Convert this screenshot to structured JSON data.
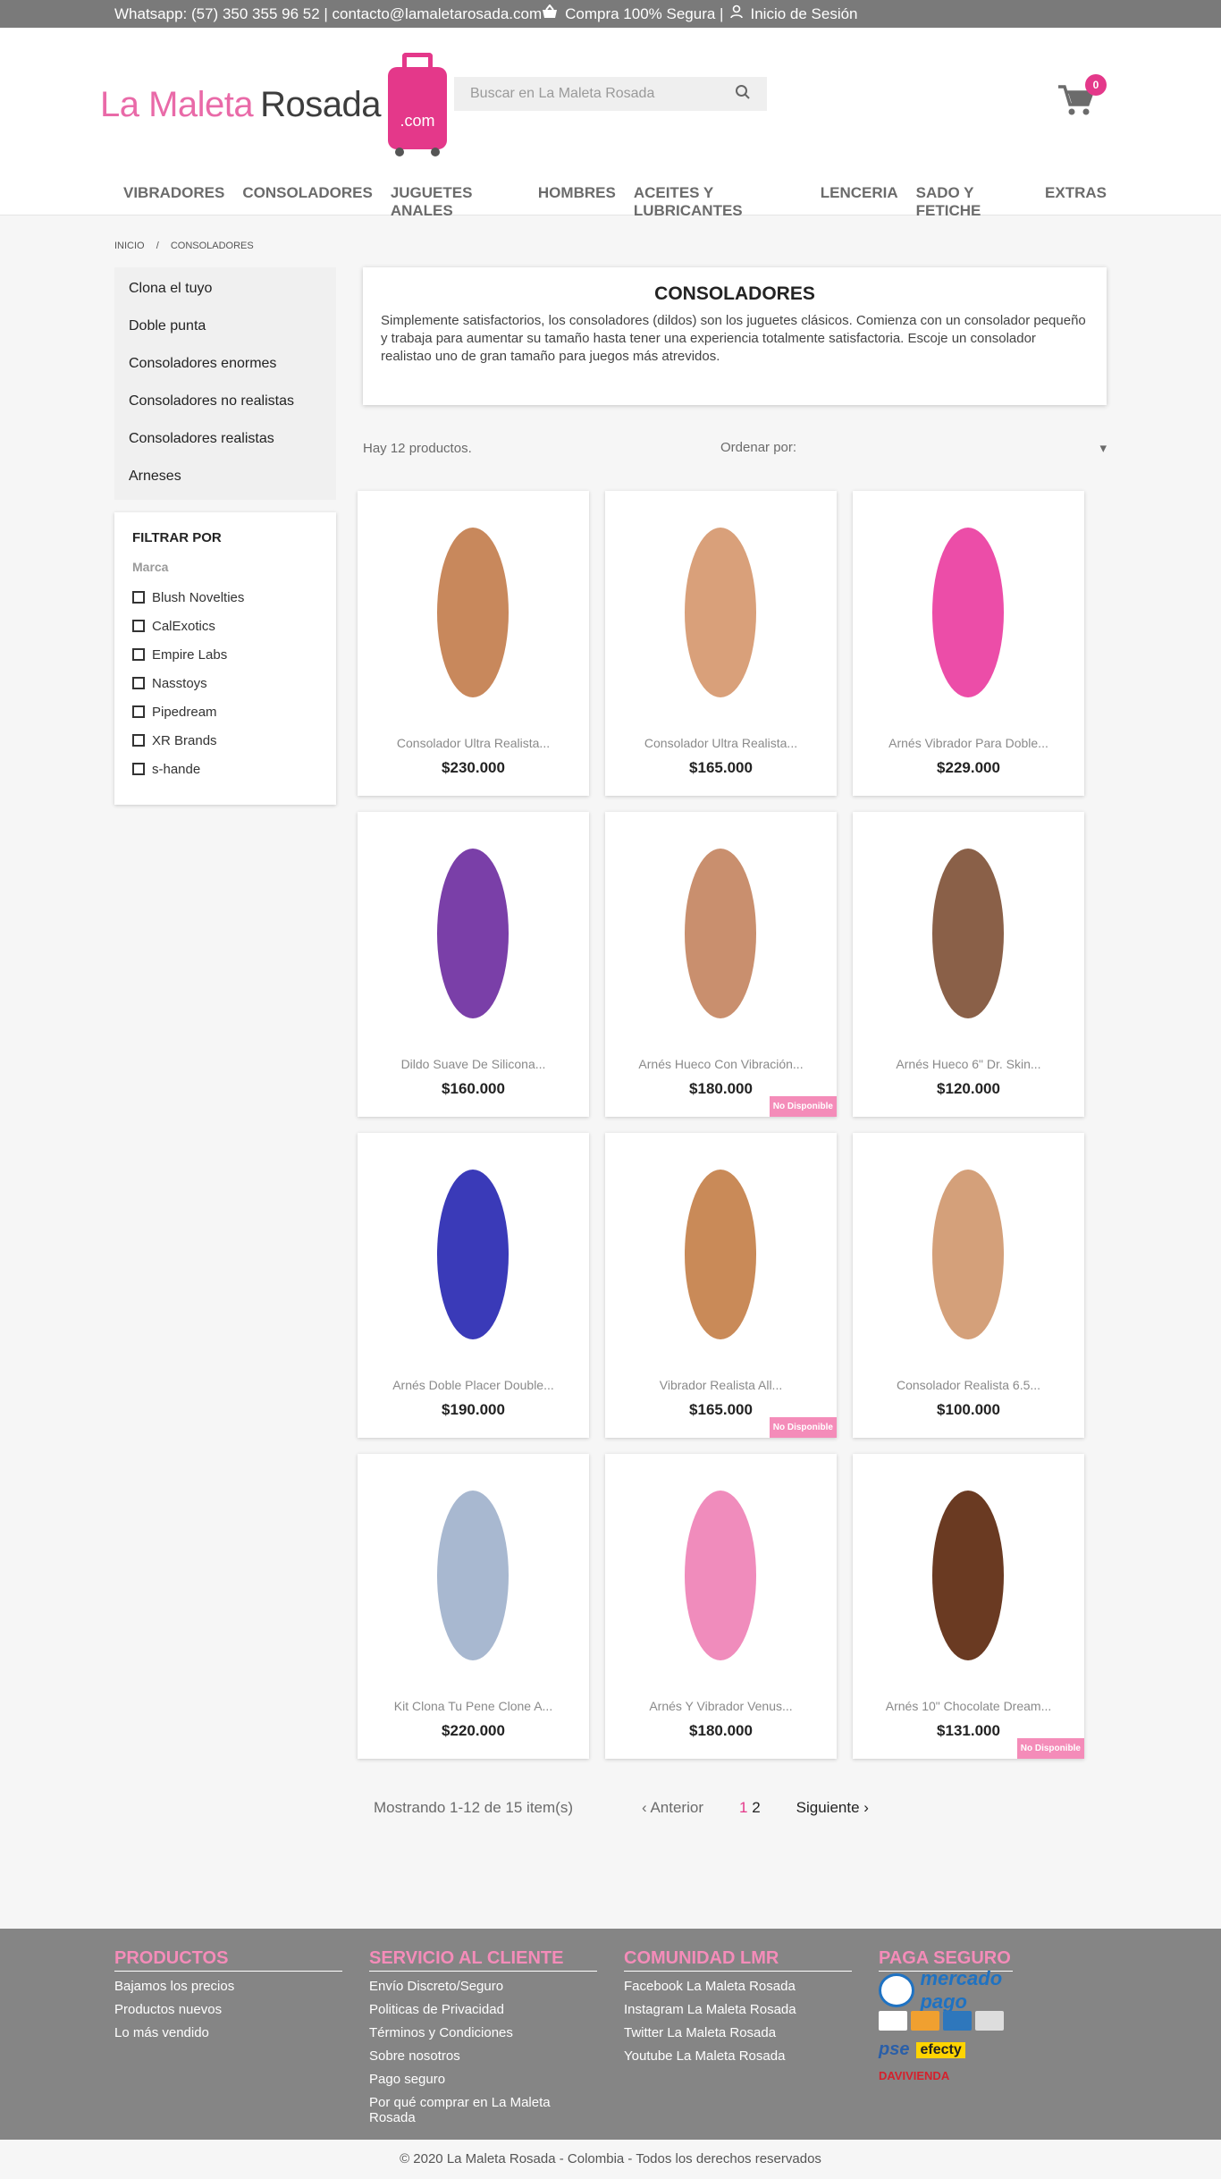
{
  "topbar": {
    "contact": "Whatsapp: (57) 350 355 96 52 | contacto@lamaletarosada.com",
    "secure": "Compra 100% Segura |",
    "login": "Inicio de Sesión"
  },
  "logo": {
    "word1": "La Maleta",
    "word2": "Rosada",
    "suffix": ".com"
  },
  "search": {
    "placeholder": "Buscar en La Maleta Rosada"
  },
  "cart": {
    "count": "0"
  },
  "nav": [
    "VIBRADORES",
    "CONSOLADORES",
    "JUGUETES ANALES",
    "HOMBRES",
    "ACEITES Y LUBRICANTES",
    "LENCERIA",
    "SADO Y FETICHE",
    "EXTRAS"
  ],
  "breadcrumb": {
    "home": "INICIO",
    "sep": "/",
    "current": "CONSOLADORES"
  },
  "categories": [
    "Clona el tuyo",
    "Doble punta",
    "Consoladores enormes",
    "Consoladores no realistas",
    "Consoladores realistas",
    "Arneses"
  ],
  "filter": {
    "title": "FILTRAR POR",
    "group": "Marca",
    "brands": [
      "Blush Novelties",
      "CalExotics",
      "Empire Labs",
      "Nasstoys",
      "Pipedream",
      "XR Brands",
      "s-hande"
    ]
  },
  "category": {
    "title": "CONSOLADORES",
    "description": "Simplemente satisfactorios, los consoladores (dildos) son los juguetes clásicos. Comienza con un consolador pequeño y trabaja para aumentar su tamaño hasta tener una experiencia totalmente satisfactoria. Escoje un consolador realistao uno de gran tamaño para juegos más atrevidos."
  },
  "listing": {
    "count": "Hay 12 productos.",
    "sort": "Ordenar por:"
  },
  "products": [
    {
      "name": "Consolador Ultra Realista...",
      "price": "$230.000",
      "badge": "",
      "color": "#c8885c"
    },
    {
      "name": "Consolador Ultra Realista...",
      "price": "$165.000",
      "badge": "",
      "color": "#d9a07a"
    },
    {
      "name": "Arnés Vibrador Para Doble...",
      "price": "$229.000",
      "badge": "",
      "color": "#ec4da8"
    },
    {
      "name": "Dildo Suave De Silicona...",
      "price": "$160.000",
      "badge": "",
      "color": "#7a3fa8"
    },
    {
      "name": "Arnés Hueco Con Vibración...",
      "price": "$180.000",
      "badge": "No Disponible",
      "color": "#c98f6e"
    },
    {
      "name": "Arnés Hueco 6\" Dr. Skin...",
      "price": "$120.000",
      "badge": "",
      "color": "#8a6048"
    },
    {
      "name": "Arnés Doble Placer Double...",
      "price": "$190.000",
      "badge": "",
      "color": "#3a3ab8"
    },
    {
      "name": "Vibrador Realista All...",
      "price": "$165.000",
      "badge": "No Disponible",
      "color": "#c98a58"
    },
    {
      "name": "Consolador Realista 6.5...",
      "price": "$100.000",
      "badge": "",
      "color": "#d4a07a"
    },
    {
      "name": "Kit Clona Tu Pene Clone A...",
      "price": "$220.000",
      "badge": "",
      "color": "#a8b8d0"
    },
    {
      "name": "Arnés Y Vibrador Venus...",
      "price": "$180.000",
      "badge": "",
      "color": "#f08cbc"
    },
    {
      "name": "Arnés 10\" Chocolate Dream...",
      "price": "$131.000",
      "badge": "No Disponible",
      "color": "#6a3a22"
    }
  ],
  "pagination": {
    "showing": "Mostrando 1-12 de 15 item(s)",
    "prev": "Anterior",
    "page1": "1",
    "page2": "2",
    "next": "Siguiente"
  },
  "footer": {
    "products": {
      "title": "PRODUCTOS",
      "links": [
        "Bajamos los precios",
        "Productos nuevos",
        "Lo más vendido"
      ]
    },
    "service": {
      "title": "SERVICIO AL CLIENTE",
      "links": [
        "Envío Discreto/Seguro",
        "Politicas de Privacidad",
        "Términos y Condiciones",
        "Sobre nosotros",
        "Pago seguro",
        "Por qué comprar en La Maleta Rosada"
      ]
    },
    "community": {
      "title": "COMUNIDAD LMR",
      "links": [
        "Facebook La Maleta Rosada",
        "Instagram La Maleta Rosada",
        "Twitter La Maleta Rosada",
        "Youtube La Maleta Rosada"
      ]
    },
    "pay": {
      "title": "PAGA SEGURO",
      "mp": "mercado pago",
      "pse": "pse",
      "efecty": "efecty",
      "dav": "DAVIVIENDA"
    }
  },
  "copyright": "© 2020 La Maleta Rosada - Colombia - Todos los derechos reservados"
}
